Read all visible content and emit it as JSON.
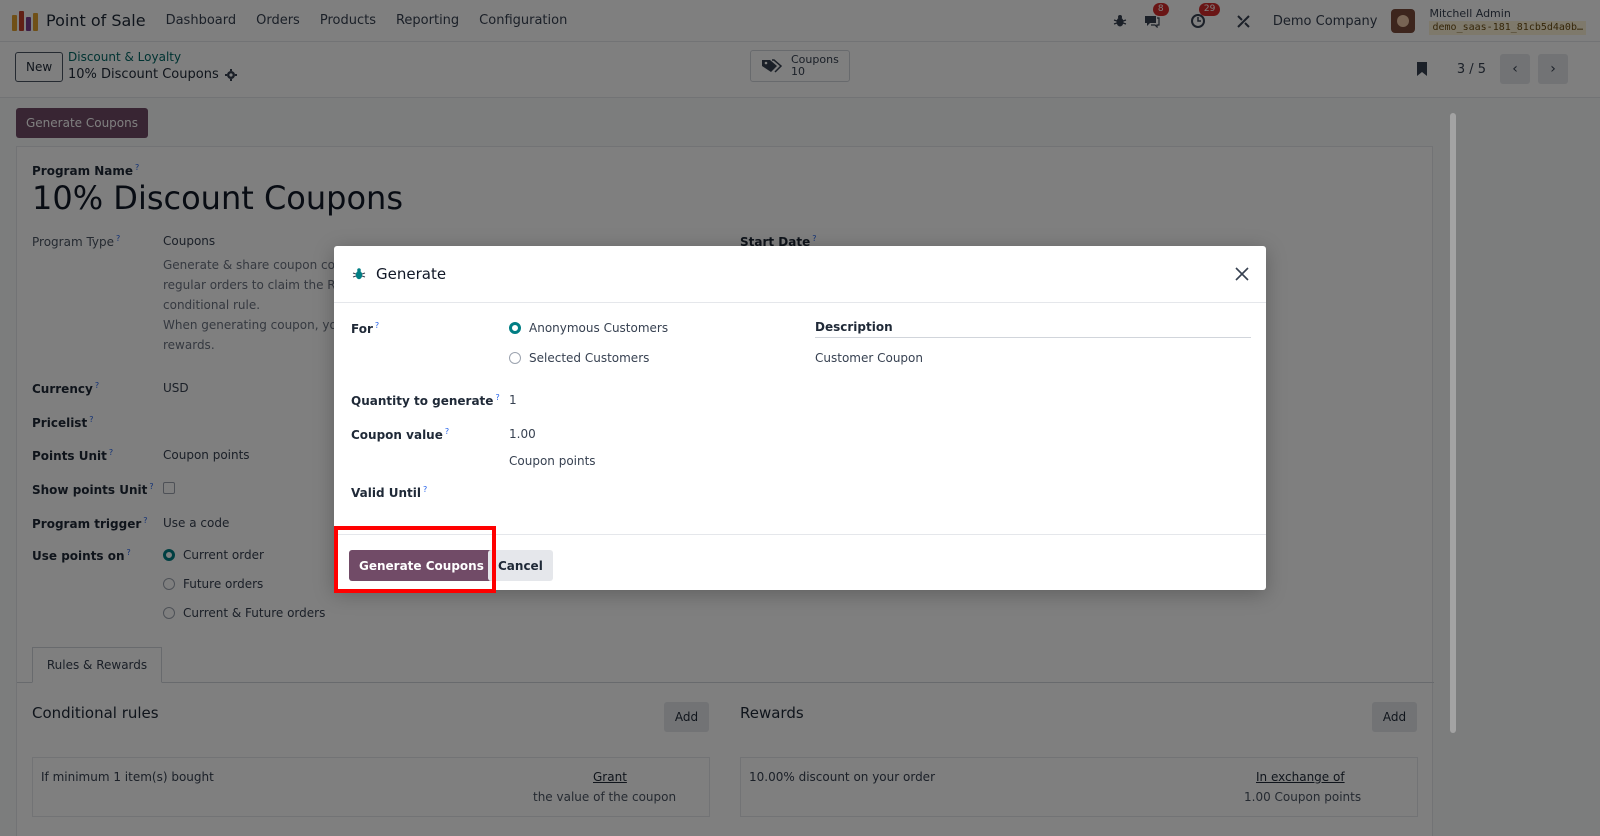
{
  "navbar": {
    "app_name": "Point of Sale",
    "menu": [
      "Dashboard",
      "Orders",
      "Products",
      "Reporting",
      "Configuration"
    ],
    "messages_badge": "8",
    "activities_badge": "29",
    "company": "Demo Company",
    "user_name": "Mitchell Admin",
    "database": "demo_saas-181_81cb5d4a0b…"
  },
  "control": {
    "new_label": "New",
    "breadcrumb_parent": "Discount & Loyalty",
    "breadcrumb_current": "10% Discount Coupons",
    "smart_button_label": "Coupons",
    "smart_button_count": "10",
    "pager": "3 / 5"
  },
  "form": {
    "header_button": "Generate Coupons",
    "program_name_label": "Program Name",
    "program_name": "10% Discount Coupons",
    "program_type_label": "Program Type",
    "program_type": "Coupons",
    "program_type_desc_1": "Generate & share coupon co",
    "program_type_desc_2": "regular orders to claim the R",
    "program_type_desc_3": "conditional rule.",
    "program_type_desc_4": "When generating coupon, yo",
    "program_type_desc_5": "rewards.",
    "start_date_label": "Start Date",
    "currency_label": "Currency",
    "currency": "USD",
    "pricelist_label": "Pricelist",
    "points_unit_label": "Points Unit",
    "points_unit": "Coupon points",
    "show_points_unit_label": "Show points Unit",
    "program_trigger_label": "Program trigger",
    "program_trigger": "Use a code",
    "use_points_on_label": "Use points on",
    "use_points_options": [
      "Current order",
      "Future orders",
      "Current & Future orders"
    ],
    "tab_label": "Rules & Rewards",
    "conditional_rules_title": "Conditional rules",
    "rewards_title": "Rewards",
    "add_label": "Add",
    "rule_text": "If minimum 1 item(s) bought",
    "rule_grant": "Grant",
    "rule_grant_value": "the value of the coupon",
    "reward_text": "10.00% discount on your order",
    "reward_exchange": "In exchange of",
    "reward_exchange_value": "1.00 Coupon points"
  },
  "modal": {
    "title": "Generate",
    "for_label": "For",
    "for_options": [
      "Anonymous Customers",
      "Selected Customers"
    ],
    "for_selected": "Anonymous Customers",
    "description_label": "Description",
    "description_value": "Customer Coupon",
    "quantity_label": "Quantity to generate",
    "quantity_value": "1",
    "coupon_value_label": "Coupon value",
    "coupon_value": "1.00",
    "coupon_value_unit": "Coupon points",
    "valid_until_label": "Valid Until",
    "generate_button": "Generate Coupons",
    "cancel_button": "Cancel"
  },
  "colors": {
    "primary": "#714b67",
    "accent_teal": "#017e84",
    "highlight": "#ff0000"
  },
  "icons": [
    "app-logo-icon",
    "bug-icon",
    "chat-icon",
    "clock-icon",
    "tools-icon",
    "gear-icon",
    "tag-icon",
    "bookmark-icon",
    "chevron-left-icon",
    "chevron-right-icon",
    "close-icon"
  ]
}
